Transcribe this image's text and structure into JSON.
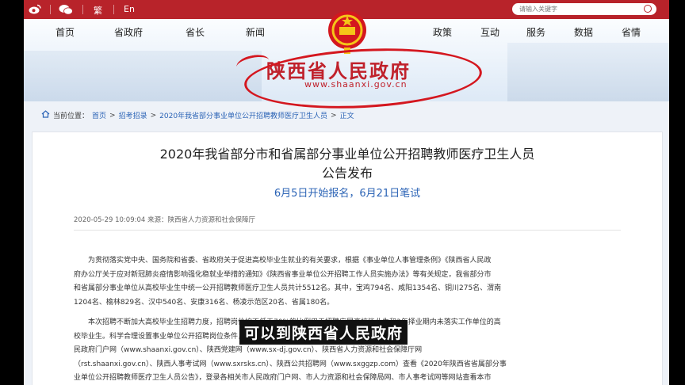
{
  "topbar": {
    "lang_trad": "繁",
    "lang_en": "En",
    "search_placeholder": "请输入关键字"
  },
  "nav": {
    "left": [
      "首页",
      "省政府",
      "省长",
      "新闻"
    ],
    "right": [
      "政策",
      "互动",
      "服务",
      "数据",
      "省情"
    ]
  },
  "header": {
    "title_cn": "陕西省人民政府",
    "title_en": "www.shaanxi.gov.cn"
  },
  "breadcrumb": {
    "label": "当前位置：",
    "items": [
      "首页",
      "招考招录",
      "2020年我省部分事业单位公开招聘教师医疗卫生人员",
      "正文"
    ]
  },
  "article": {
    "title_line1": "2020年我省部分市和省属部分事业单位公开招聘教师医疗卫生人员",
    "title_line2": "公告发布",
    "subtitle": "6月5日开始报名，6月21日笔试",
    "meta": "2020-05-29 10:09:04   来源：陕西省人力资源和社会保障厅",
    "p1_lines": [
      "为贯彻落实党中央、国务院和省委、省政府关于促进高校毕业生就业的有关要求，根据《事业单位人事管理条例》《陕西省人民政",
      "府办公厅关于应对新冠肺炎疫情影响强化稳就业举措的通知》《陕西省事业单位公开招聘工作人员实施办法》等有关规定，我省部分市",
      "和省属部分事业单位从高校毕业生中统一公开招聘教师医疗卫生人员共计5512名。其中，宝鸡794名、咸阳1354名、铜川275名、渭南",
      "1204名、榆林829名、汉中540名、安康316名、杨凌示范区20名、省属180名。"
    ],
    "p2_lines": [
      "本次招聘不断加大高校毕业生招聘力度，招聘岗位均不低于70%的比例用于招聘应届高校毕业生和2年择业期内未落实工作单位的高",
      "校毕业生。科学合理设置事业单位公开招聘岗位条件，                         格条件。即日起，应聘人员可登录陕西省人",
      "民政府门户网（www.shaanxi.gov.cn）、陕西党建网（www.sx-dj.gov.cn）、陕西省人力资源和社会保障厅网",
      "（rst.shaanxi.gov.cn）、陕西人事考试网（www.sxrsks.cn）、陕西公共招聘网（www.sxggzp.com）查看《2020年陕西省省属部分事",
      "业单位公开招聘教师医疗卫生人员公告》，登录各相关市人民政府门户网、市人力资源和社会保障局网、市人事考试网等网站查看本市"
    ]
  },
  "caption": "可以到陕西省人民政府"
}
